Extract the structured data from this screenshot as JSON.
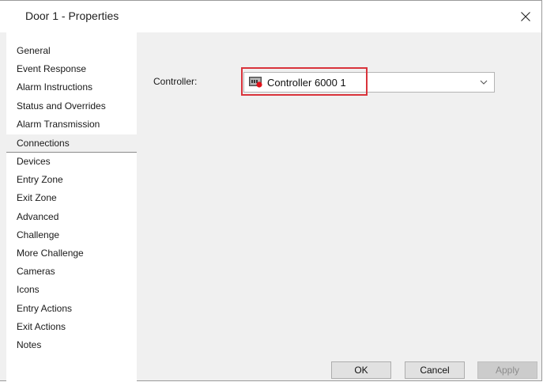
{
  "window": {
    "title": "Door 1 - Properties",
    "close_icon": "close-icon"
  },
  "nav": {
    "top_items": [
      {
        "label": "General"
      },
      {
        "label": "Event Response"
      },
      {
        "label": "Alarm Instructions"
      },
      {
        "label": "Status and Overrides"
      },
      {
        "label": "Alarm Transmission"
      }
    ],
    "active_item": {
      "label": "Connections"
    },
    "bottom_items": [
      {
        "label": "Devices"
      },
      {
        "label": "Entry Zone"
      },
      {
        "label": "Exit Zone"
      },
      {
        "label": "Advanced"
      },
      {
        "label": "Challenge"
      },
      {
        "label": "More Challenge"
      },
      {
        "label": "Cameras"
      },
      {
        "label": "Icons"
      },
      {
        "label": "Entry Actions"
      },
      {
        "label": "Exit Actions"
      },
      {
        "label": "Notes"
      }
    ]
  },
  "connections": {
    "controller_label": "Controller:",
    "controller_value": "Controller 6000 1",
    "controller_icon": "controller-offline-icon"
  },
  "buttons": {
    "ok": "OK",
    "cancel": "Cancel",
    "apply": "Apply"
  },
  "colors": {
    "highlight": "#d9333b",
    "status_dot": "#e0121b"
  }
}
